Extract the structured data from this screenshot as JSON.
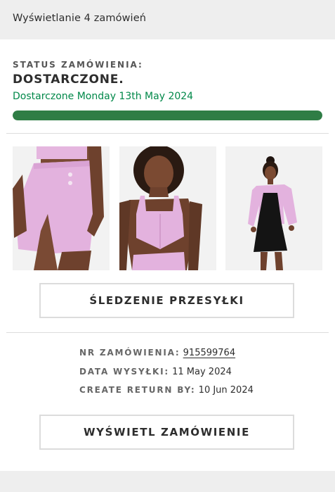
{
  "header": {
    "orders_count_text": "Wyświetlanie 4 zamówień"
  },
  "order": {
    "status_label": "STATUS ZAMÓWIENIA:",
    "status_value": "DOSTARCZONE.",
    "status_detail": "Dostarczone Monday 13th May 2024",
    "progress_percent": 100,
    "colors": {
      "progress": "#2f7d45",
      "status_detail": "#018849",
      "product_pink": "#e3b2de"
    },
    "products": [
      {
        "image": "product-photo-pink-skirt"
      },
      {
        "image": "product-photo-pink-corset-top"
      },
      {
        "image": "product-photo-pink-blazer"
      }
    ],
    "track_button_label": "ŚLEDZENIE PRZESYŁKI",
    "order_number_label": "NR ZAMÓWIENIA:",
    "order_number_value": "915599764",
    "ship_date_label": "DATA WYSYŁKI:",
    "ship_date_value": "11 May 2024",
    "return_label": "CREATE RETURN BY:",
    "return_value": "10 Jun 2024",
    "view_order_button_label": "WYŚWIETL ZAMÓWIENIE"
  }
}
